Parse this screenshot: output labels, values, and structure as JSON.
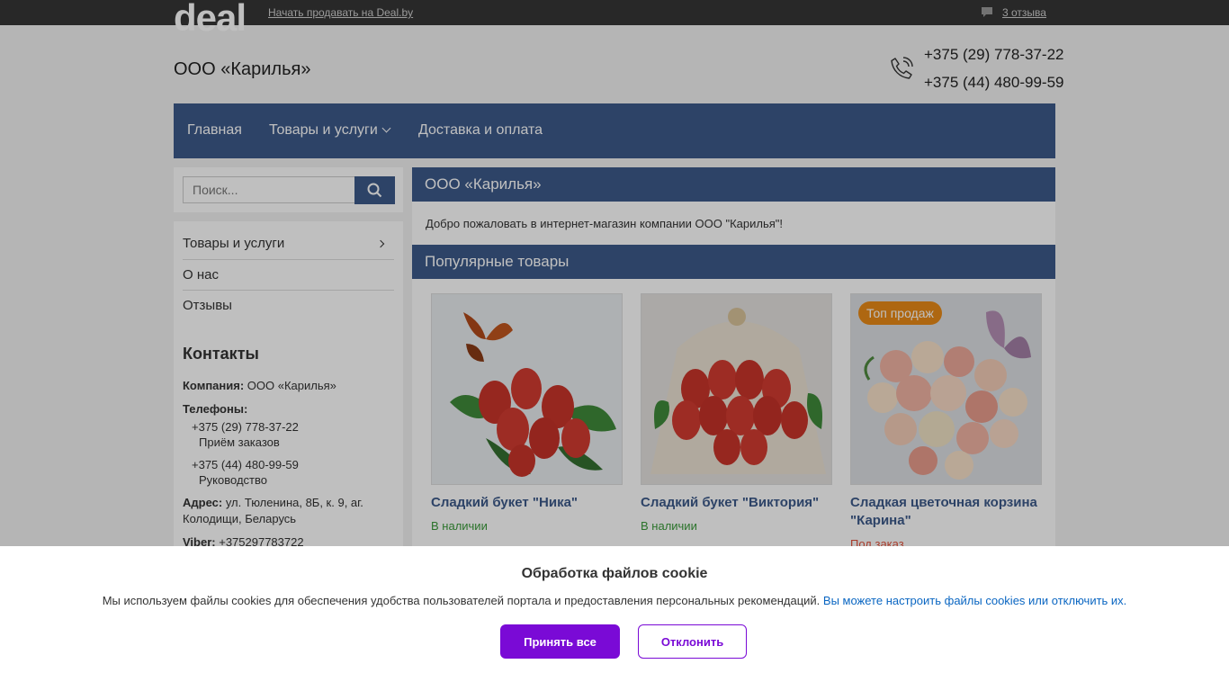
{
  "topbar": {
    "logo": "deal",
    "sell_link": "Начать продавать на Deal.by",
    "reviews_link": "3 отзыва",
    "reviews_icon": "speech-bubble-icon"
  },
  "header": {
    "company_title": "ООО «Карилья»",
    "phone_icon": "phone-icon",
    "phone1": "+375 (29) 778-37-22",
    "phone2": "+375 (44) 480-99-59"
  },
  "nav": {
    "items": [
      {
        "label": "Главная"
      },
      {
        "label": "Товары и услуги"
      },
      {
        "label": "Доставка и оплата"
      }
    ]
  },
  "search": {
    "placeholder": "Поиск...",
    "icon": "search-icon"
  },
  "sidebar": {
    "links": [
      {
        "label": "Товары и услуги"
      },
      {
        "label": "О нас"
      },
      {
        "label": "Отзывы"
      }
    ],
    "contacts_heading": "Контакты",
    "company_label": "Компания:",
    "company_value": "ООО «Карилья»",
    "phones_label": "Телефоны:",
    "phone1": "+375 (29) 778-37-22",
    "phone1_note": "Приём заказов",
    "phone2": "+375 (44) 480-99-59",
    "phone2_note": "Руководство",
    "address_label": "Адрес:",
    "address_value": "ул. Тюленина, 8Б, к. 9, аг. Колодищи, Беларусь",
    "viber_label": "Viber:",
    "viber_value": "+375297783722"
  },
  "main": {
    "title": "ООО «Карилья»",
    "welcome": "Добро пожаловать в интернет-магазин компании ООО \"Карилья\"!",
    "popular_heading": "Популярные товары",
    "products": [
      {
        "name": "Сладкий букет \"Ника\"",
        "status": "В наличии",
        "status_color": "#3a9a3a"
      },
      {
        "name": "Сладкий букет \"Виктория\"",
        "status": "В наличии",
        "status_color": "#3a9a3a"
      },
      {
        "name": "Сладкая цветочная корзина \"Карина\"",
        "status": "Под заказ",
        "status_color": "#e0503a",
        "badge": "Топ продаж"
      }
    ]
  },
  "cookie": {
    "title": "Обработка файлов cookie",
    "text": "Мы используем файлы cookies для обеспечения удобства пользователей портала и предоставления персональных рекомендаций.",
    "link": "Вы можете настроить файлы cookies или отключить их.",
    "accept": "Принять все",
    "decline": "Отклонить",
    "accent_color": "#7a0ad6"
  }
}
